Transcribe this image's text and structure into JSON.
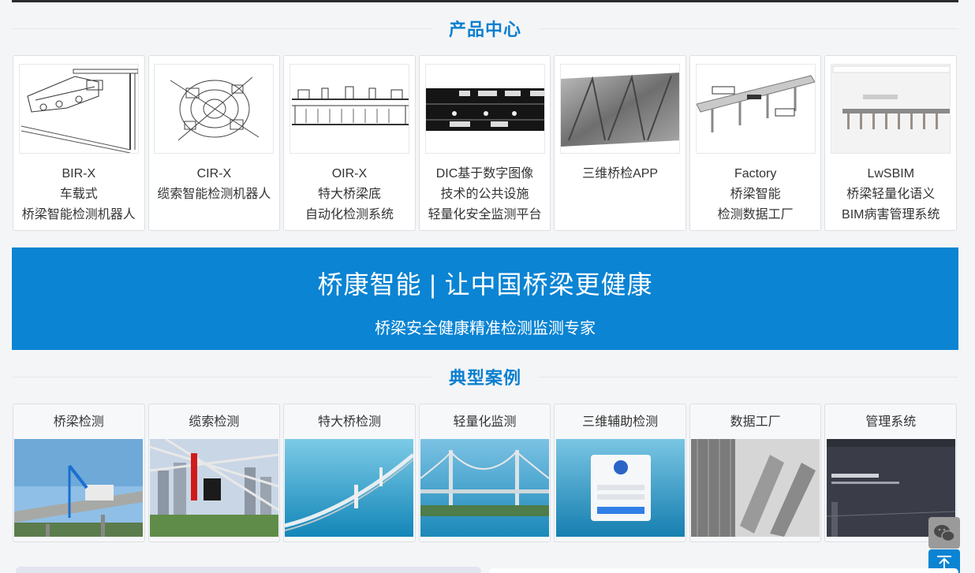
{
  "products": {
    "title": "产品中心",
    "items": [
      {
        "lines": [
          "BIR-X",
          "车载式",
          "桥梁智能检测机器人"
        ],
        "icon": "vehicle-inspection-robot-drawing"
      },
      {
        "lines": [
          "CIR-X",
          "缆索智能检测机器人"
        ],
        "icon": "cable-robot-drawing"
      },
      {
        "lines": [
          "OIR-X",
          "特大桥梁底",
          "自动化检测系统"
        ],
        "icon": "bridge-underside-system-drawing"
      },
      {
        "lines": [
          "DIC基于数字图像",
          "技术的公共设施",
          "轻量化安全监测平台"
        ],
        "icon": "monitoring-dashboard"
      },
      {
        "lines": [
          "三维桥检APP"
        ],
        "icon": "3d-bridge-surface"
      },
      {
        "lines": [
          "Factory",
          "桥梁智能",
          "检测数据工厂"
        ],
        "icon": "bridge-3d-model"
      },
      {
        "lines": [
          "LwSBIM",
          "桥梁轻量化语义",
          "BIM病害管理系统"
        ],
        "icon": "bim-bridge-model"
      }
    ]
  },
  "banner": {
    "headline": "桥康智能 | 让中国桥梁更健康",
    "subline": "桥梁安全健康精准检测监测专家",
    "color": "#0b84d3"
  },
  "cases": {
    "title": "典型案例",
    "items": [
      {
        "label": "桥梁检测",
        "icon": "truck-on-bridge-photo"
      },
      {
        "label": "缆索检测",
        "icon": "cable-robot-photo"
      },
      {
        "label": "特大桥检测",
        "icon": "sea-bridge-photo"
      },
      {
        "label": "轻量化监测",
        "icon": "suspension-bridge-photo"
      },
      {
        "label": "三维辅助检测",
        "icon": "login-screen"
      },
      {
        "label": "数据工厂",
        "icon": "3d-scan-render"
      },
      {
        "label": "管理系统",
        "icon": "bim-system-screen"
      }
    ]
  },
  "floating": {
    "wechat_icon": "wechat-icon",
    "top_icon": "back-to-top-icon"
  },
  "accent_color": "#0a7fd0"
}
